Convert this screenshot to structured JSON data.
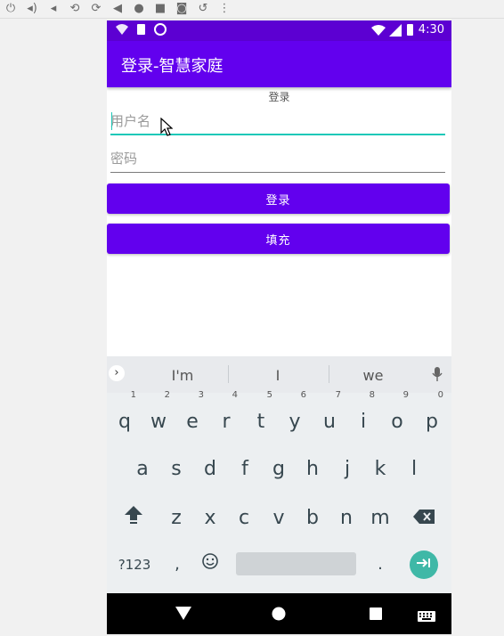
{
  "emulator_toolbar": {
    "icons": [
      "power-icon",
      "volume-up-icon",
      "volume-down-icon",
      "rotate-left-icon",
      "rotate-right-icon",
      "back-icon",
      "home-icon",
      "overview-icon",
      "camera-icon",
      "replay-icon",
      "more-icon"
    ],
    "glyphs": [
      "⏻",
      "🔊",
      "🔉",
      "⟲",
      "⟳",
      "◀",
      "●",
      "■",
      "📷",
      "⟲",
      "⋮"
    ]
  },
  "status_bar": {
    "time": "4:30"
  },
  "app_bar": {
    "title": "登录-智慧家庭"
  },
  "form": {
    "heading": "登录",
    "username_placeholder": "用户名",
    "password_placeholder": "密码",
    "login_button": "登录",
    "fill_button": "填充"
  },
  "keyboard": {
    "suggestions": [
      "I'm",
      "I",
      "we"
    ],
    "row1": [
      "q",
      "w",
      "e",
      "r",
      "t",
      "y",
      "u",
      "i",
      "o",
      "p"
    ],
    "row1_hints": [
      "1",
      "2",
      "3",
      "4",
      "5",
      "6",
      "7",
      "8",
      "9",
      "0"
    ],
    "row2": [
      "a",
      "s",
      "d",
      "f",
      "g",
      "h",
      "j",
      "k",
      "l"
    ],
    "row3": [
      "z",
      "x",
      "c",
      "v",
      "b",
      "n",
      "m"
    ],
    "symbols_key": "?123",
    "comma_key": ",",
    "period_key": "."
  },
  "colors": {
    "status_bar": "#5c00d2",
    "app_bar": "#6200ee",
    "button": "#6200ee",
    "focus_line": "#1ec8b8",
    "enter_key": "#3fb8a7"
  }
}
